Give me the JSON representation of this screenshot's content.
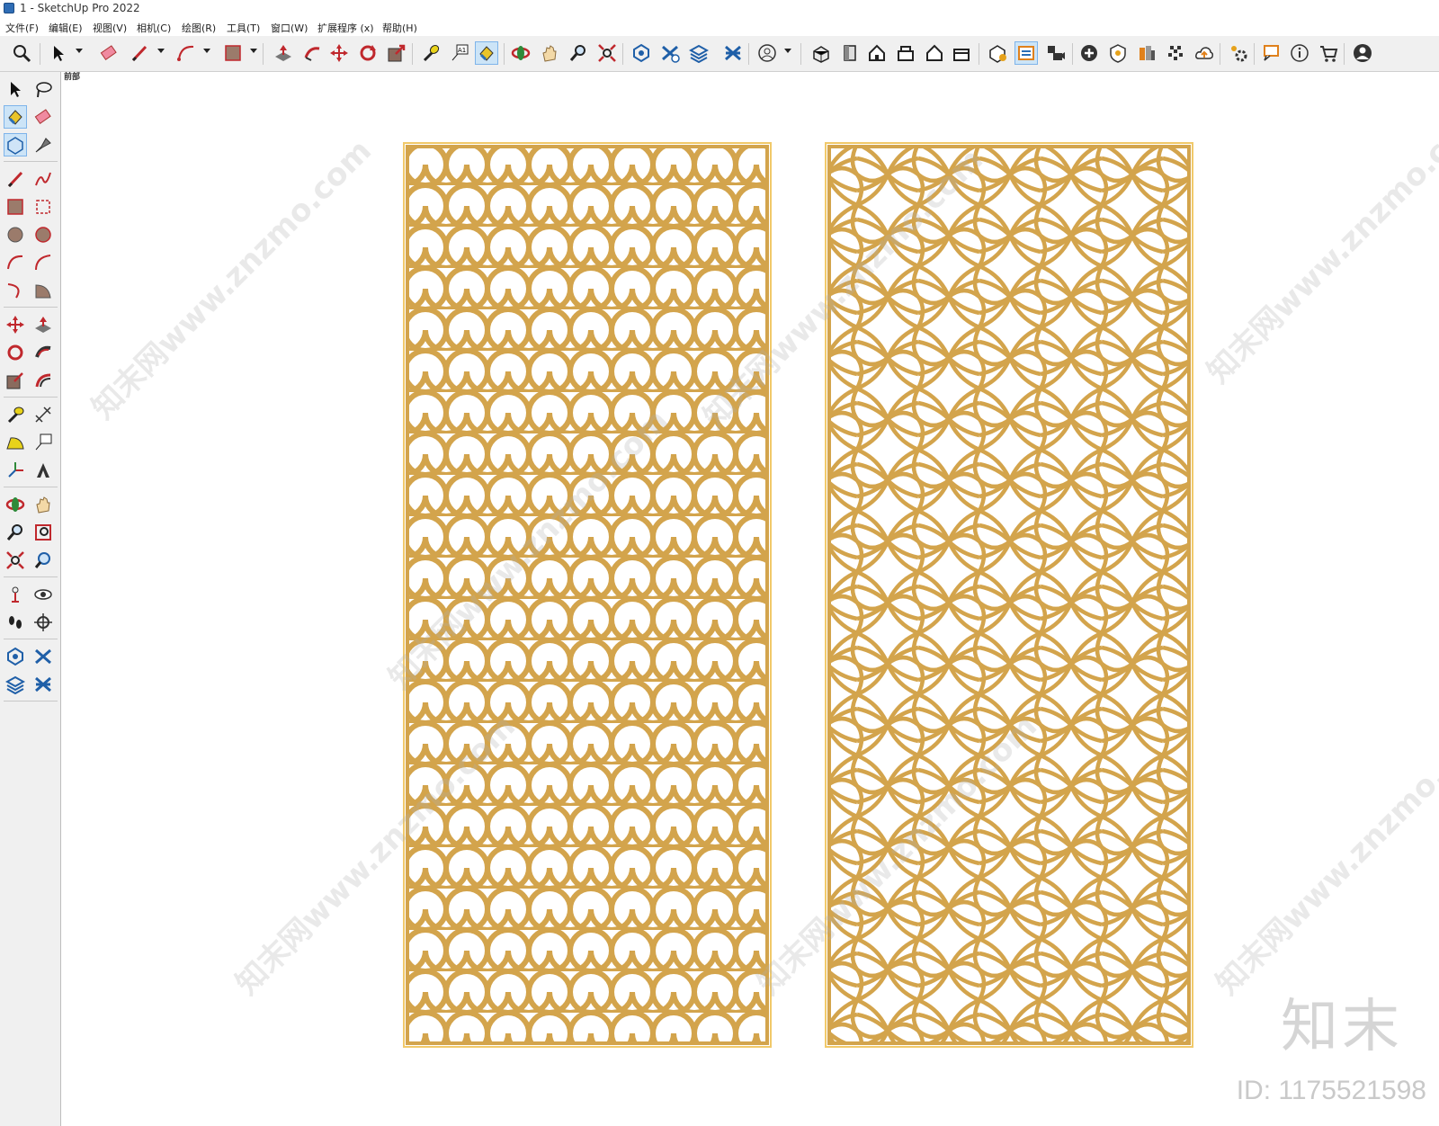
{
  "window": {
    "title": "1 - SketchUp Pro 2022"
  },
  "menu": [
    {
      "label": "文件(F)"
    },
    {
      "label": "编辑(E)"
    },
    {
      "label": "视图(V)"
    },
    {
      "label": "相机(C)"
    },
    {
      "label": "绘图(R)"
    },
    {
      "label": "工具(T)"
    },
    {
      "label": "窗口(W)"
    },
    {
      "label": "扩展程序 (x)"
    },
    {
      "label": "帮助(H)"
    }
  ],
  "scene": {
    "tab_label": "前部"
  },
  "colors": {
    "pattern": "#d3a44c",
    "frame": "#f1c96a",
    "accent": "#2f6db5"
  },
  "toolbar_icons": [
    "zoom-extents-icon",
    "select-icon",
    "eraser-icon",
    "pencil-icon",
    "arc-icon",
    "rectangle-icon",
    "push-pull-icon",
    "follow-me-icon",
    "move-icon",
    "rotate-icon",
    "scale-icon",
    "tape-measure-icon",
    "text-icon",
    "paint-bucket-icon",
    "orbit-icon",
    "pan-icon",
    "zoom-icon",
    "zoom-window-icon",
    "warehouse-icon",
    "extension-icon",
    "layers-icon",
    "styles-icon",
    "account-icon",
    "iso-view-icon",
    "top-view-icon",
    "front-view-icon",
    "right-view-icon",
    "back-view-icon",
    "left-view-icon",
    "components-icon",
    "tags-icon",
    "scenes-icon",
    "add-icon",
    "shadow-icon",
    "materials-icon",
    "texture-icon",
    "cloud-upload-icon",
    "settings-icon",
    "comment-icon",
    "info-icon",
    "cart-icon",
    "profile-icon"
  ],
  "watermark": {
    "text": "知末网www.znzmo.com",
    "logo": "知末",
    "id": "ID: 1175521598"
  }
}
